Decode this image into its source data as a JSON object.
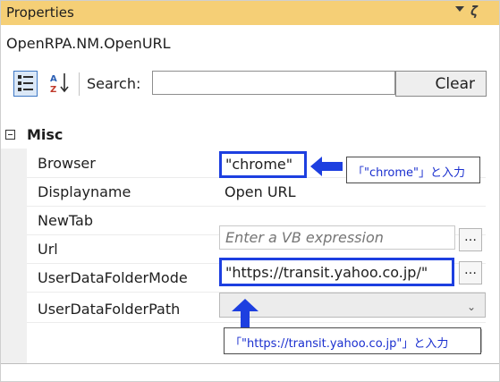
{
  "panel": {
    "title": "Properties",
    "object_name": "OpenRPA.NM.OpenURL"
  },
  "toolbar": {
    "categorized_icon": "categorized-view-icon",
    "alphabetical_icon": "sort-alphabetical-icon",
    "search_label": "Search:",
    "search_value": "",
    "clear_label": "Clear"
  },
  "category": {
    "name": "Misc"
  },
  "properties": [
    {
      "name": "Browser",
      "value": "\"chrome\""
    },
    {
      "name": "Displayname",
      "value": "Open URL"
    },
    {
      "name": "NewTab",
      "placeholder": "Enter a VB expression"
    },
    {
      "name": "Url",
      "value": "\"https://transit.yahoo.co.jp/\""
    },
    {
      "name": "UserDataFolderMode",
      "value": ""
    },
    {
      "name": "UserDataFolderPath",
      "value": ""
    }
  ],
  "annotations": {
    "browser_callout": "「\"chrome\"」と入力",
    "url_callout": "「\"https://transit.yahoo.co.jp\"」と入力",
    "highlight_color": "#1d3fe0",
    "arrow_color": "#1d3fe0"
  },
  "colors": {
    "title_bar": "#f5cf76",
    "selected_toolbar_button": "#dbe8f7"
  }
}
